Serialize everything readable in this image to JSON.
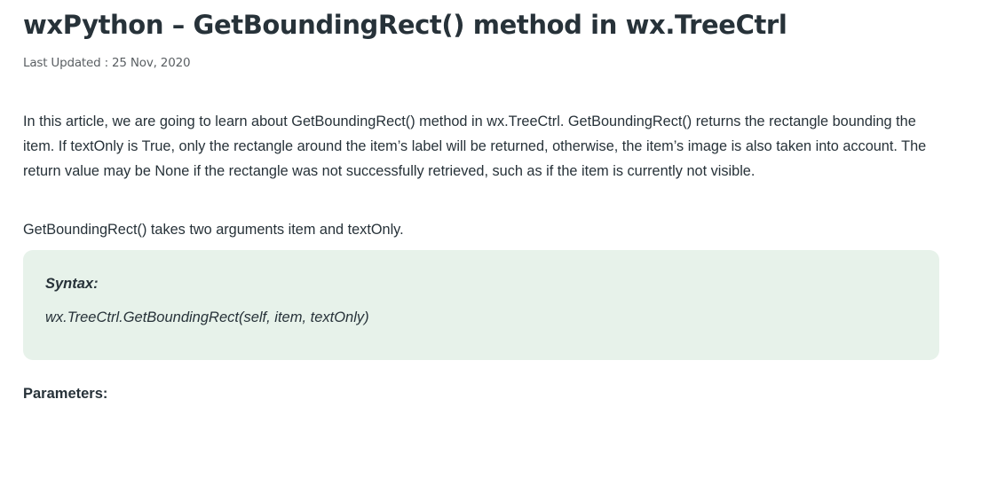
{
  "article": {
    "title": "wxPython – GetBoundingRect() method in wx.TreeCtrl",
    "last_updated": "Last Updated : 25 Nov, 2020",
    "paragraph1": "In this article, we are going to learn about GetBoundingRect() method in wx.TreeCtrl. GetBoundingRect() returns the rectangle bounding the item. If textOnly is True, only the rectangle around the item’s label will be returned, otherwise, the item’s image is also taken into account. The return value may be None if the rectangle was not successfully retrieved, such as if the item is currently not visible.",
    "paragraph2": "GetBoundingRect() takes two arguments item and textOnly.",
    "syntax": {
      "label": "Syntax:",
      "code": "wx.TreeCtrl.GetBoundingRect(self, item, textOnly)"
    },
    "parameters_heading": "Parameters:"
  },
  "colors": {
    "text": "#273239",
    "muted": "#5a5f63",
    "syntax_bg": "#e7f2ea",
    "page_bg": "#ffffff"
  }
}
